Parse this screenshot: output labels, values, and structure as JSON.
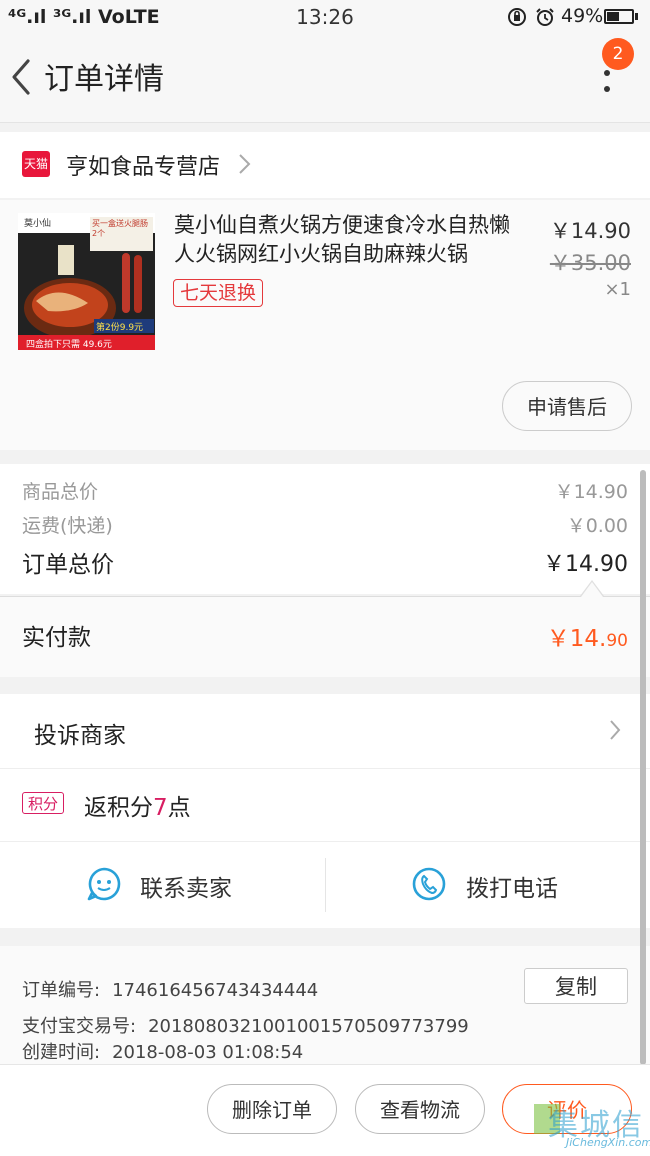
{
  "status_bar": {
    "network": "⁴ᴳ.ıl ³ᴳ.ıl VoLTE",
    "time": "13:26",
    "battery_percent": "49%",
    "battery_level": 0.49,
    "icons": [
      "data-saver-icon",
      "alarm-icon",
      "battery-icon"
    ]
  },
  "header": {
    "title": "订单详情",
    "notification_count": "2",
    "icons": [
      "back-chevron-icon",
      "more-vertical-icon"
    ]
  },
  "store": {
    "badge": "天猫",
    "name": "亨如食品专营店"
  },
  "product": {
    "title": "莫小仙自煮火锅方便速食冷水自热懒人火锅网红小火锅自助麻辣火锅",
    "price": "￥14.90",
    "original_price": "￥35.00",
    "quantity": "×1",
    "return_policy": "七天退换",
    "after_sale_button": "申请售后",
    "image": {
      "brand": "莫小仙",
      "promo_top": "买一盒送火腿肠2个",
      "promo_mid": "第2份9.9元",
      "promo_bottom": "四盒拍下只需 49.6元"
    }
  },
  "summary": {
    "goods_total_label": "商品总价",
    "goods_total_value": "￥14.90",
    "shipping_label": "运费(快递)",
    "shipping_value": "￥0.00",
    "order_total_label": "订单总价",
    "order_total_value": "￥14.90",
    "paid_label": "实付款",
    "paid_value_main": "￥14.",
    "paid_value_cents": "90"
  },
  "complain": {
    "label": "投诉商家"
  },
  "points": {
    "tag": "积分",
    "prefix": "返积分",
    "amount": "7",
    "suffix": "点"
  },
  "contact": {
    "seller_label": "联系卖家",
    "call_label": "拨打电话"
  },
  "order_info": {
    "order_no_label": "订单编号:",
    "order_no": "174616456743434444",
    "alipay_label": "支付宝交易号:",
    "alipay_no": "2018080321001001570509773799",
    "created_label": "创建时间:",
    "created_time": "2018-08-03 01:08:54",
    "copy_button": "复制"
  },
  "bottom_bar": {
    "delete_button": "删除订单",
    "logistics_button": "查看物流",
    "review_button": "评价"
  },
  "watermark": {
    "text": "集城信",
    "sub": "JiChengXin.com"
  },
  "colors": {
    "accent_orange": "#ff5a1f",
    "tmall_red": "#e8173b",
    "return_red": "#e4393c",
    "points_pink": "#d81e62",
    "icon_blue": "#29a1d8"
  }
}
